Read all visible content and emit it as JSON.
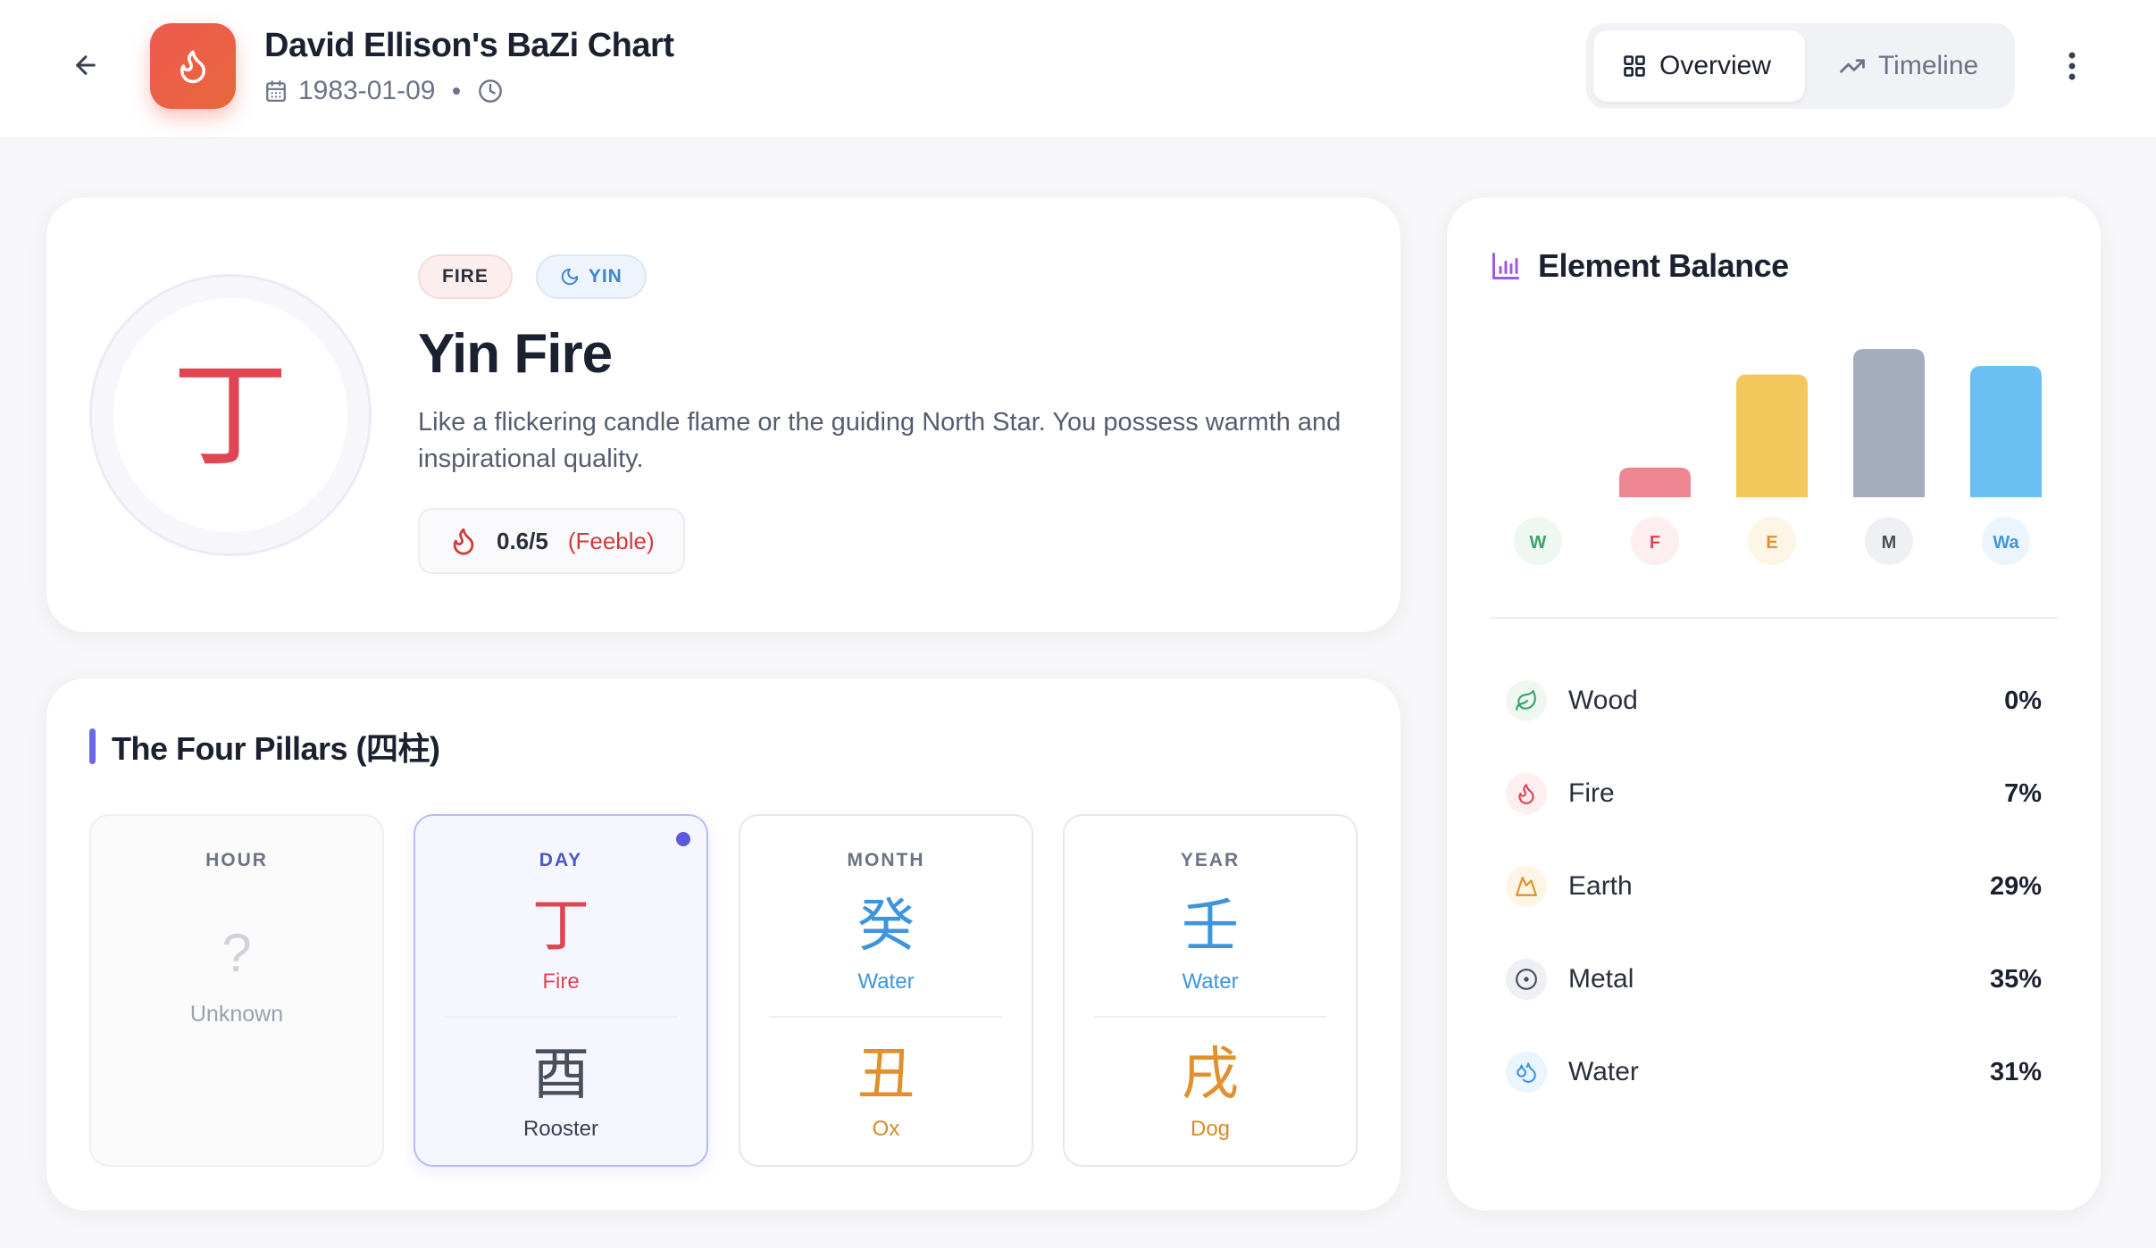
{
  "header": {
    "title": "David Ellison's BaZi Chart",
    "date": "1983-01-09",
    "views": [
      {
        "label": "Overview",
        "icon": "grid-icon",
        "active": true
      },
      {
        "label": "Timeline",
        "icon": "trending-up-icon",
        "active": false
      }
    ]
  },
  "day_master": {
    "character": "丁",
    "badges": {
      "element": "FIRE",
      "polarity": "YIN"
    },
    "title": "Yin Fire",
    "description": "Like a flickering candle flame or the guiding North Star. You possess warmth and inspirational quality.",
    "strength_score": "0.6/5",
    "strength_label": "(Feeble)"
  },
  "pillars": {
    "heading": "The Four Pillars (四柱)",
    "items": [
      {
        "label": "HOUR",
        "unknown_mark": "?",
        "unknown_text": "Unknown"
      },
      {
        "label": "DAY",
        "stem_char": "丁",
        "stem_name": "Fire",
        "branch_char": "酉",
        "branch_name": "Rooster",
        "stem_color": "#e04553",
        "branch_color": "#4a4f5c"
      },
      {
        "label": "MONTH",
        "stem_char": "癸",
        "stem_name": "Water",
        "branch_char": "丑",
        "branch_name": "Ox",
        "stem_color": "#3f95dc",
        "branch_color": "#e0902c"
      },
      {
        "label": "YEAR",
        "stem_char": "壬",
        "stem_name": "Water",
        "branch_char": "戌",
        "branch_name": "Dog",
        "stem_color": "#3f95dc",
        "branch_color": "#e0902c"
      }
    ]
  },
  "balance": {
    "heading": "Element Balance",
    "elements": [
      {
        "name": "Wood",
        "percent": "0%",
        "icon": "leaf-icon",
        "color": "#3aa36a"
      },
      {
        "name": "Fire",
        "percent": "7%",
        "icon": "flame-icon",
        "color": "#e04553"
      },
      {
        "name": "Earth",
        "percent": "29%",
        "icon": "mountain-icon",
        "color": "#e0902c"
      },
      {
        "name": "Metal",
        "percent": "35%",
        "icon": "circle-dot-icon",
        "color": "#4a4f5c"
      },
      {
        "name": "Water",
        "percent": "31%",
        "icon": "droplets-icon",
        "color": "#3f95dc"
      }
    ]
  },
  "chart_data": {
    "type": "bar",
    "categories": [
      "W",
      "F",
      "E",
      "M",
      "Wa"
    ],
    "values": [
      0,
      7,
      29,
      35,
      31
    ],
    "colors": [
      "#6cc08f",
      "#ec8791",
      "#f2c85c",
      "#a3adbd",
      "#6cbff2"
    ],
    "label_bg": [
      "#eef8f1",
      "#fdeef0",
      "#fdf6e6",
      "#eef0f3",
      "#ebf5fd"
    ],
    "label_fg": [
      "#3aa36a",
      "#e04553",
      "#e0902c",
      "#4a4f5c",
      "#3f95dc"
    ],
    "ylim": [
      0,
      35
    ],
    "grid": false,
    "legend": "none"
  }
}
